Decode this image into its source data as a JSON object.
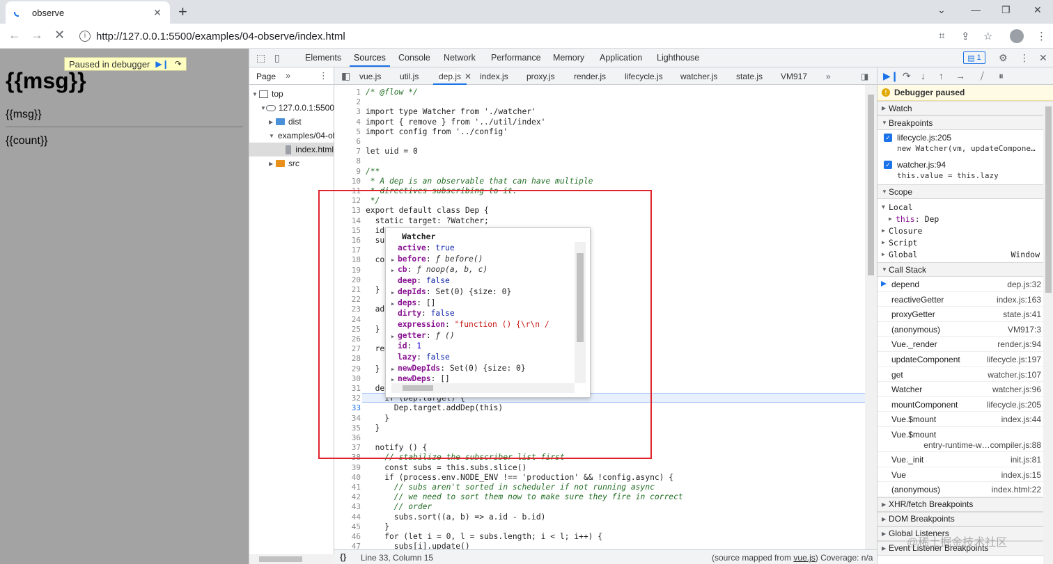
{
  "browser": {
    "tab_title": "observe",
    "url": "http://127.0.0.1:5500/examples/04-observe/index.html"
  },
  "page": {
    "heading": "{{msg}}",
    "msg_text": "{{msg}}",
    "count_text": "{{count}}",
    "paused_label": "Paused in debugger"
  },
  "devtools": {
    "tabs": [
      "Elements",
      "Sources",
      "Console",
      "Network",
      "Performance",
      "Memory",
      "Application",
      "Lighthouse"
    ],
    "active_tab": "Sources",
    "issues_count": "1"
  },
  "navigator": {
    "header": "Page",
    "tree": [
      "top",
      "127.0.0.1:5500",
      "dist",
      "examples/04-observe",
      "index.html",
      "src"
    ]
  },
  "editor": {
    "file_tabs": [
      "vue.js",
      "util.js",
      "dep.js",
      "index.js",
      "proxy.js",
      "render.js",
      "lifecycle.js",
      "watcher.js",
      "state.js",
      "VM917"
    ],
    "active_file": "dep.js",
    "status_position": "Line 33, Column 15",
    "status_map_prefix": "(source mapped from ",
    "status_map_file": "vue.js",
    "status_map_suffix": ")  Coverage: n/a"
  },
  "popover": {
    "title": "Watcher",
    "props": [
      {
        "key": "active",
        "value": "true",
        "kind": "bool",
        "expandable": false
      },
      {
        "key": "before",
        "value": "ƒ before()",
        "kind": "fn",
        "expandable": true
      },
      {
        "key": "cb",
        "value": "ƒ noop(a, b, c)",
        "kind": "fn",
        "expandable": true
      },
      {
        "key": "deep",
        "value": "false",
        "kind": "bool",
        "expandable": false
      },
      {
        "key": "depIds",
        "value": "Set(0) {size: 0}",
        "kind": "obj",
        "expandable": true
      },
      {
        "key": "deps",
        "value": "[]",
        "kind": "obj",
        "expandable": true
      },
      {
        "key": "dirty",
        "value": "false",
        "kind": "bool",
        "expandable": false
      },
      {
        "key": "expression",
        "value": "\"function () {\\r\\n        /",
        "kind": "str",
        "expandable": false
      },
      {
        "key": "getter",
        "value": "ƒ ()",
        "kind": "fn",
        "expandable": true
      },
      {
        "key": "id",
        "value": "1",
        "kind": "num",
        "expandable": false
      },
      {
        "key": "lazy",
        "value": "false",
        "kind": "bool",
        "expandable": false
      },
      {
        "key": "newDepIds",
        "value": "Set(0) {size: 0}",
        "kind": "obj",
        "expandable": true
      },
      {
        "key": "newDeps",
        "value": "[]",
        "kind": "obj",
        "expandable": true
      }
    ]
  },
  "sidebar": {
    "paused_banner": "Debugger paused",
    "watch_label": "Watch",
    "breakpoints_label": "Breakpoints",
    "breakpoints": [
      {
        "file": "lifecycle.js:205",
        "code": "new Watcher(vm, updateCompone…"
      },
      {
        "file": "watcher.js:94",
        "code": "this.value = this.lazy"
      }
    ],
    "scope_label": "Scope",
    "scope": {
      "local": "Local",
      "this_key": "this",
      "this_val": "Dep",
      "closure": "Closure",
      "script": "Script",
      "global": "Global",
      "global_val": "Window"
    },
    "callstack_label": "Call Stack",
    "callstack": [
      {
        "fn": "depend",
        "loc": "dep.js:32"
      },
      {
        "fn": "reactiveGetter",
        "loc": "index.js:163"
      },
      {
        "fn": "proxyGetter",
        "loc": "state.js:41"
      },
      {
        "fn": "(anonymous)",
        "loc": "VM917:3"
      },
      {
        "fn": "Vue._render",
        "loc": "render.js:94"
      },
      {
        "fn": "updateComponent",
        "loc": "lifecycle.js:197"
      },
      {
        "fn": "get",
        "loc": "watcher.js:107"
      },
      {
        "fn": "Watcher",
        "loc": "watcher.js:96"
      },
      {
        "fn": "mountComponent",
        "loc": "lifecycle.js:205"
      },
      {
        "fn": "Vue.$mount",
        "loc": "index.js:44"
      },
      {
        "fn": "Vue.$mount",
        "loc": "entry-runtime-w…compiler.js:88"
      },
      {
        "fn": "Vue._init",
        "loc": "init.js:81"
      },
      {
        "fn": "Vue",
        "loc": "index.js:15"
      },
      {
        "fn": "(anonymous)",
        "loc": "index.html:22"
      }
    ],
    "more_sections": [
      "XHR/fetch Breakpoints",
      "DOM Breakpoints",
      "Global Listeners",
      "Event Listener Breakpoints"
    ]
  },
  "watermark": "@稀土掘金技术社区",
  "code_lines": [
    {
      "n": "1",
      "t": "/* @flow */",
      "c": "cm"
    },
    {
      "n": "2",
      "t": "",
      "c": ""
    },
    {
      "n": "3",
      "t": "import type Watcher from './watcher'",
      "c": ""
    },
    {
      "n": "4",
      "t": "import { remove } from '../util/index'",
      "c": ""
    },
    {
      "n": "5",
      "t": "import config from '../config'",
      "c": ""
    },
    {
      "n": "6",
      "t": "",
      "c": ""
    },
    {
      "n": "7",
      "t": "let uid = 0",
      "c": ""
    },
    {
      "n": "8",
      "t": "",
      "c": ""
    },
    {
      "n": "9",
      "t": "/**",
      "c": "cm"
    },
    {
      "n": "10",
      "t": " * A dep is an observable that can have multiple",
      "c": "cm"
    },
    {
      "n": "11",
      "t": " * directives subscribing to it.",
      "c": "cm"
    },
    {
      "n": "12",
      "t": " */",
      "c": "cm"
    },
    {
      "n": "13",
      "t": "export default class Dep {",
      "c": ""
    },
    {
      "n": "14",
      "t": "  static target: ?Watcher;",
      "c": ""
    },
    {
      "n": "15",
      "t": "  id",
      "c": ""
    },
    {
      "n": "16",
      "t": "  sub",
      "c": ""
    },
    {
      "n": "17",
      "t": "",
      "c": ""
    },
    {
      "n": "18",
      "t": "  con",
      "c": ""
    },
    {
      "n": "19",
      "t": "    t",
      "c": ""
    },
    {
      "n": "20",
      "t": "    t",
      "c": ""
    },
    {
      "n": "21",
      "t": "  }",
      "c": ""
    },
    {
      "n": "22",
      "t": "",
      "c": ""
    },
    {
      "n": "23",
      "t": "  add",
      "c": ""
    },
    {
      "n": "24",
      "t": "    t",
      "c": ""
    },
    {
      "n": "25",
      "t": "  }",
      "c": ""
    },
    {
      "n": "26",
      "t": "",
      "c": ""
    },
    {
      "n": "27",
      "t": "  rem",
      "c": ""
    },
    {
      "n": "28",
      "t": "    r",
      "c": ""
    },
    {
      "n": "29",
      "t": "  }",
      "c": ""
    },
    {
      "n": "30",
      "t": "",
      "c": ""
    },
    {
      "n": "31",
      "t": "  dep",
      "c": ""
    },
    {
      "n": "32",
      "t": "    if (Dep.target) {",
      "c": ""
    },
    {
      "n": "33",
      "t": "      Dep.target.addDep(this)",
      "c": ""
    },
    {
      "n": "34",
      "t": "    }",
      "c": ""
    },
    {
      "n": "35",
      "t": "  }",
      "c": ""
    },
    {
      "n": "36",
      "t": "",
      "c": ""
    },
    {
      "n": "37",
      "t": "  notify () {",
      "c": ""
    },
    {
      "n": "38",
      "t": "    // stabilize the subscriber list first",
      "c": "cm"
    },
    {
      "n": "39",
      "t": "    const subs = this.subs.slice()",
      "c": ""
    },
    {
      "n": "40",
      "t": "    if (process.env.NODE_ENV !== 'production' && !config.async) {",
      "c": ""
    },
    {
      "n": "41",
      "t": "      // subs aren't sorted in scheduler if not running async",
      "c": "cm"
    },
    {
      "n": "42",
      "t": "      // we need to sort them now to make sure they fire in correct",
      "c": "cm"
    },
    {
      "n": "43",
      "t": "      // order",
      "c": "cm"
    },
    {
      "n": "44",
      "t": "      subs.sort((a, b) => a.id - b.id)",
      "c": ""
    },
    {
      "n": "45",
      "t": "    }",
      "c": ""
    },
    {
      "n": "46",
      "t": "    for (let i = 0, l = subs.length; i < l; i++) {",
      "c": ""
    },
    {
      "n": "47",
      "t": "      subs[i].update()",
      "c": ""
    }
  ],
  "current_line": "33"
}
